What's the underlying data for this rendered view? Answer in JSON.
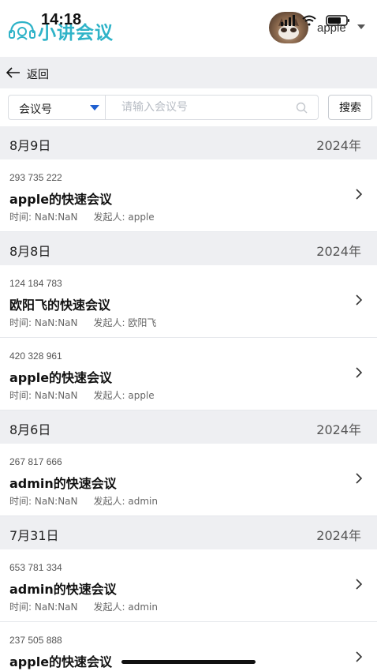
{
  "status_bar": {
    "time": "14:18"
  },
  "app": {
    "title": "小讲会议",
    "brand_color": "#2fb3c8"
  },
  "user": {
    "name": "apple"
  },
  "back": {
    "label": "返回"
  },
  "search": {
    "field_label": "会议号",
    "placeholder": "请输入会议号",
    "value": "",
    "button_label": "搜索"
  },
  "colors": {
    "accent": "#1f5fd0",
    "section_bg": "#eeeff2"
  },
  "groups": [
    {
      "date": "8月9日",
      "year": "2024年",
      "meetings": [
        {
          "number": "293 735 222",
          "title": "apple的快速会议",
          "time": "时间: NaN:NaN",
          "host": "发起人: apple"
        }
      ]
    },
    {
      "date": "8月8日",
      "year": "2024年",
      "meetings": [
        {
          "number": "124 184 783",
          "title": "欧阳飞的快速会议",
          "time": "时间: NaN:NaN",
          "host": "发起人: 欧阳飞"
        },
        {
          "number": "420 328 961",
          "title": "apple的快速会议",
          "time": "时间: NaN:NaN",
          "host": "发起人: apple"
        }
      ]
    },
    {
      "date": "8月6日",
      "year": "2024年",
      "meetings": [
        {
          "number": "267 817 666",
          "title": "admin的快速会议",
          "time": "时间: NaN:NaN",
          "host": "发起人: admin"
        }
      ]
    },
    {
      "date": "7月31日",
      "year": "2024年",
      "meetings": [
        {
          "number": "653 781 334",
          "title": "admin的快速会议",
          "time": "时间: NaN:NaN",
          "host": "发起人: admin"
        },
        {
          "number": "237 505 888",
          "title": "apple的快速会议",
          "time": "",
          "host": ""
        }
      ]
    }
  ]
}
